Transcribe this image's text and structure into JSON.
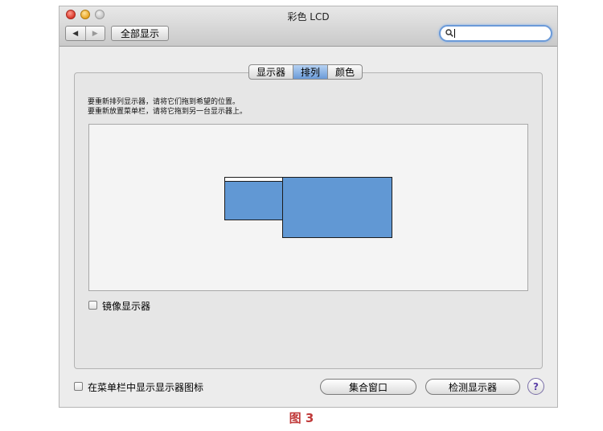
{
  "window": {
    "title": "彩色 LCD",
    "nav": {
      "back_icon": "◀",
      "forward_icon": "▶"
    },
    "show_all_label": "全部显示",
    "search": {
      "value": "",
      "placeholder": ""
    }
  },
  "tabs": [
    {
      "label": "显示器",
      "active": false
    },
    {
      "label": "排列",
      "active": true
    },
    {
      "label": "颜色",
      "active": false
    }
  ],
  "instructions": {
    "line1": "要重新排列显示器，请将它们拖到希望的位置。",
    "line2": "要重新放置菜单栏，请将它拖到另一台显示器上。"
  },
  "mirror_label": "镜像显示器",
  "menubar_checkbox_label": "在菜单栏中显示显示器图标",
  "buttons": {
    "gather_windows": "集合窗口",
    "detect_displays": "检测显示器",
    "help": "?"
  },
  "caption": "图 3",
  "colors": {
    "display_fill": "#6198d4",
    "accent": "#6b9ad8",
    "caption": "#c03a3a"
  }
}
